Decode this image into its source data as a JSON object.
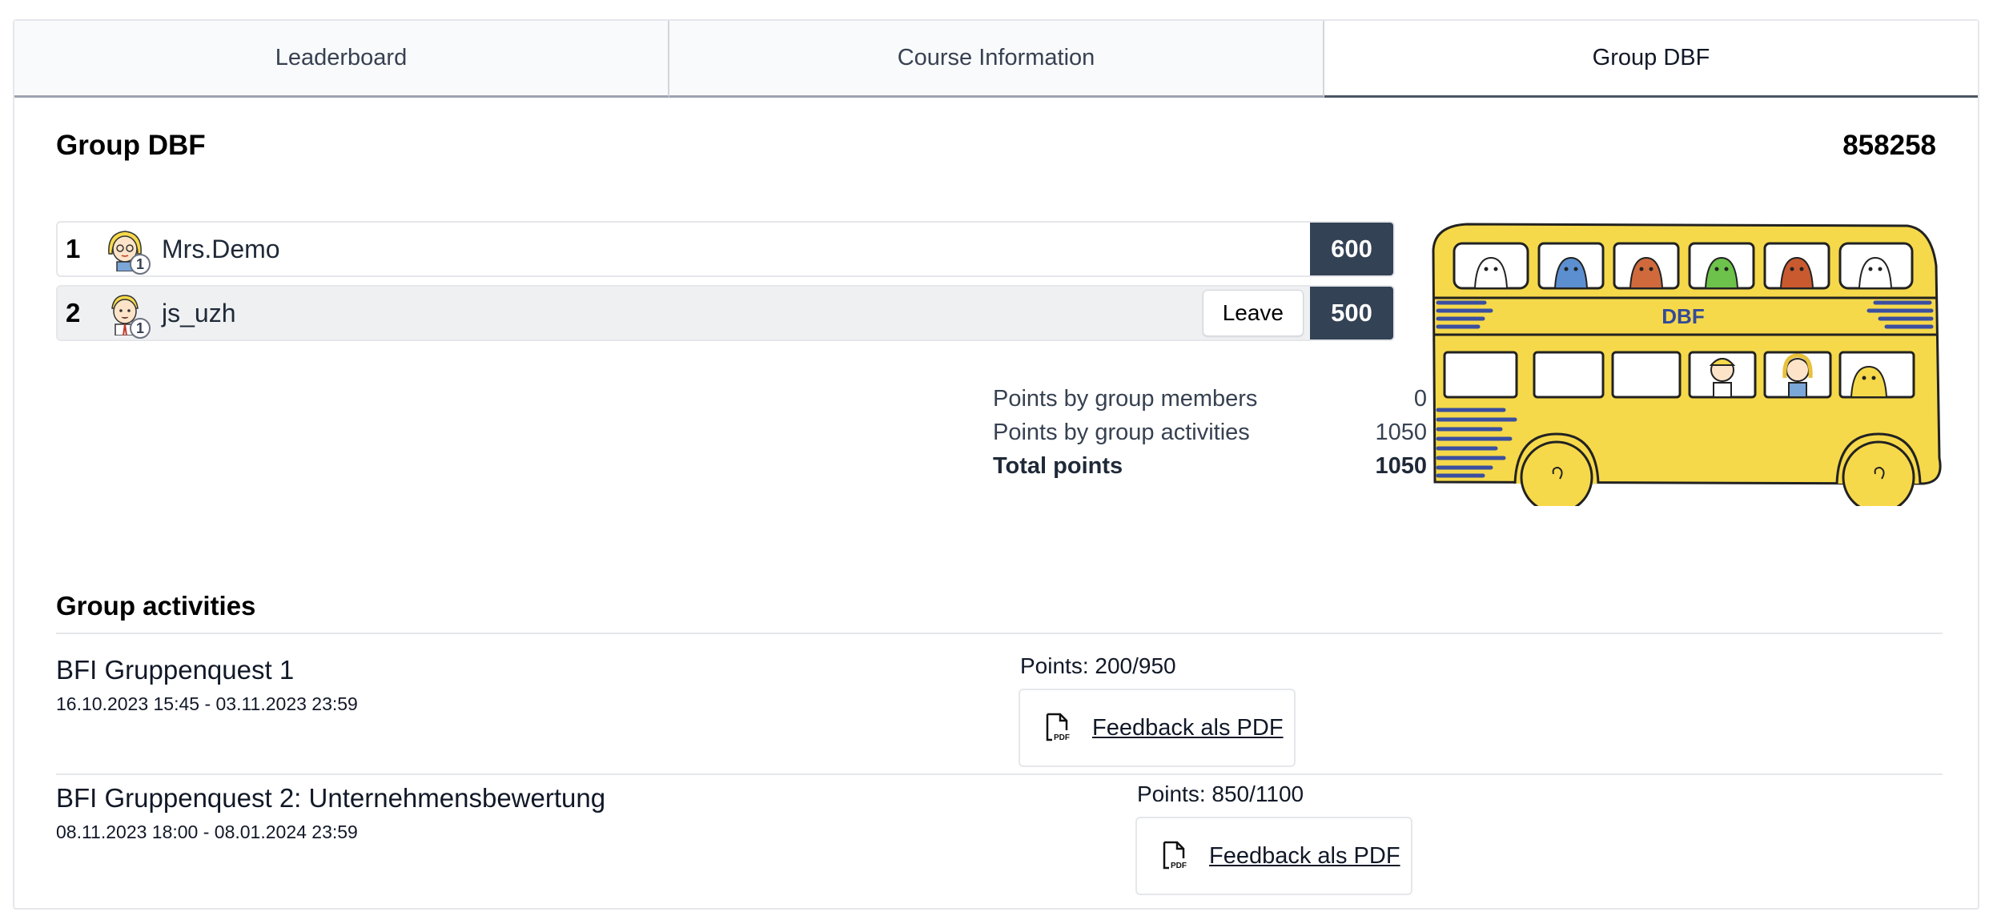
{
  "tabs": [
    {
      "label": "Leaderboard"
    },
    {
      "label": "Course Information"
    },
    {
      "label": "Group DBF"
    }
  ],
  "group": {
    "title": "Group DBF",
    "code": "858258",
    "bus_label": "DBF"
  },
  "members": [
    {
      "rank": "1",
      "name": "Mrs.Demo",
      "badge": "1",
      "score": "600"
    },
    {
      "rank": "2",
      "name": "js_uzh",
      "badge": "1",
      "score": "500",
      "leave_label": "Leave"
    }
  ],
  "points": {
    "members_label": "Points by group members",
    "members_value": "0",
    "activities_label": "Points by group activities",
    "activities_value": "1050",
    "total_label": "Total points",
    "total_value": "1050"
  },
  "activities": {
    "section_title": "Group activities",
    "items": [
      {
        "name": "BFI Gruppenquest 1",
        "dates": "16.10.2023 15:45 - 03.11.2023 23:59",
        "points": "Points: 200/950",
        "pdf_label": "Feedback als PDF"
      },
      {
        "name": "BFI Gruppenquest 2: Unternehmensbewertung",
        "dates": "08.11.2023 18:00 - 08.01.2024 23:59",
        "points": "Points: 850/1100",
        "pdf_label": "Feedback als PDF"
      }
    ]
  },
  "colors": {
    "score_bg": "#344256",
    "bus_yellow": "#f6d94a",
    "bus_stripes": "#3a4fa0"
  }
}
